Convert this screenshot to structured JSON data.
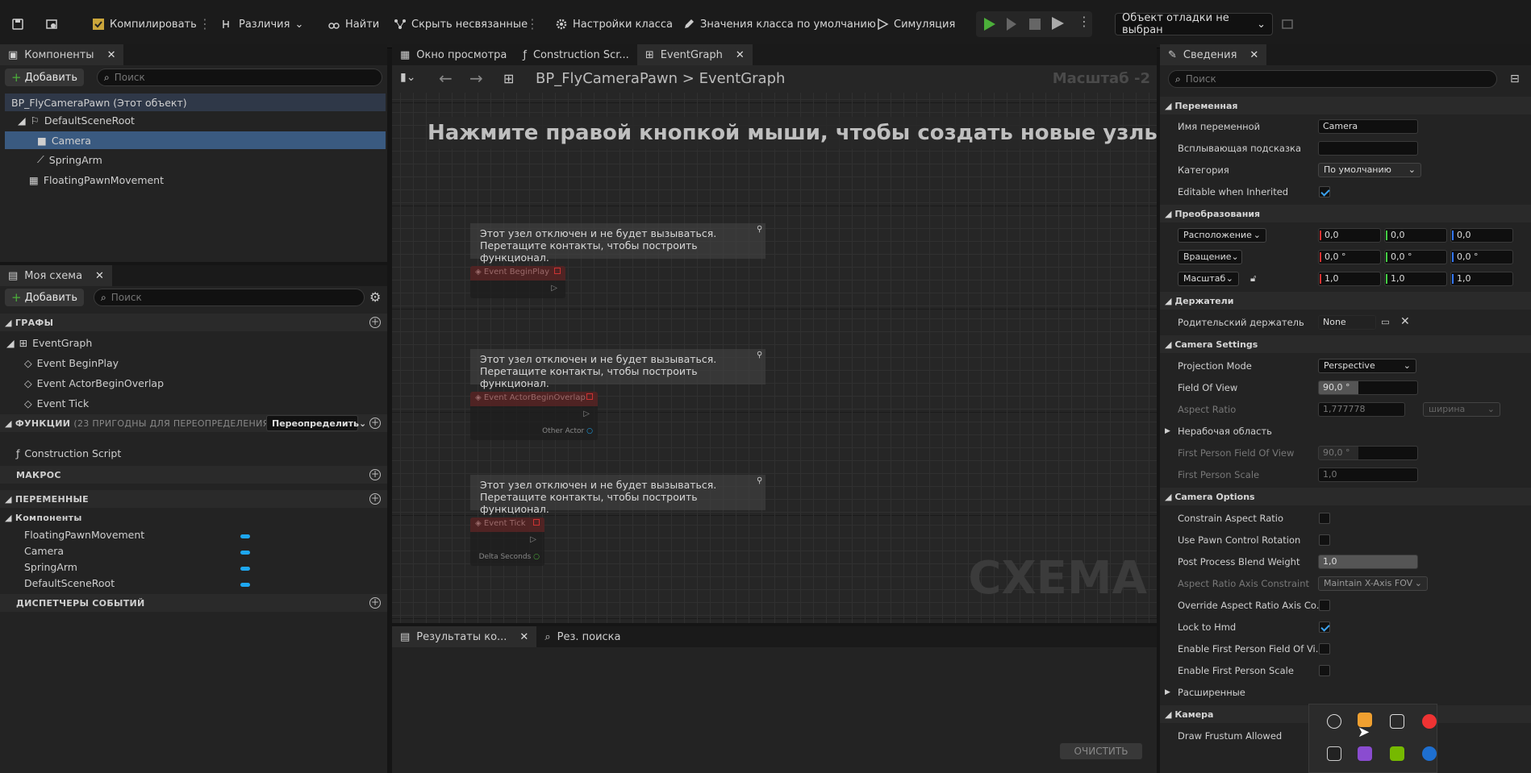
{
  "toolbar": {
    "compile": "Компилировать",
    "diff": "Различия",
    "find": "Найти",
    "hide_unrelated": "Скрыть несвязанные",
    "class_settings": "Настройки класса",
    "class_defaults": "Значения класса по умолчанию",
    "simulation": "Симуляция",
    "debug_object": "Объект отладки не выбран"
  },
  "components": {
    "tab": "Компоненты",
    "add": "Добавить",
    "search_placeholder": "Поиск",
    "items": [
      "BP_FlyCameraPawn (Этот объект)",
      "DefaultSceneRoot",
      "Camera",
      "SpringArm",
      "FloatingPawnMovement"
    ]
  },
  "myblueprint": {
    "tab": "Моя схема",
    "add": "Добавить",
    "search_placeholder": "Поиск",
    "graphs": "ГРАФЫ",
    "event_graph": "EventGraph",
    "events": [
      "Event BeginPlay",
      "Event ActorBeginOverlap",
      "Event Tick"
    ],
    "functions": "ФУНКЦИИ",
    "functions_hint": "(23 ПРИГОДНЫ ДЛЯ ПЕРЕОПРЕДЕЛЕНИЯ)",
    "override": "Переопределить",
    "construction_script": "Construction Script",
    "macros": "МАКРОС",
    "variables": "ПЕРЕМЕННЫЕ",
    "components_group": "Компоненты",
    "var_items": [
      "FloatingPawnMovement",
      "Camera",
      "SpringArm",
      "DefaultSceneRoot"
    ],
    "dispatchers": "ДИСПЕТЧЕРЫ СОБЫТИЙ"
  },
  "editor": {
    "tabs": [
      "Окно просмотра",
      "Construction Scr...",
      "EventGraph"
    ],
    "breadcrumb_root": "BP_FlyCameraPawn",
    "breadcrumb_sep": ">",
    "breadcrumb_graph": "EventGraph",
    "zoom": "Масштаб -2",
    "hint": "Нажмите правой кнопкой мыши, чтобы создать новые узлы.",
    "comment_line1": "Этот узел отключен и не будет вызываться.",
    "comment_line2": "Перетащите контакты, чтобы построить функционал.",
    "nodes": [
      "Event BeginPlay",
      "Event ActorBeginOverlap",
      "Event Tick"
    ],
    "pin_other_actor": "Other Actor",
    "pin_delta_seconds": "Delta Seconds",
    "watermark": "СХЕМА"
  },
  "results": {
    "tabs": [
      "Результаты ко...",
      "Рез. поиска"
    ],
    "clear": "ОЧИСТИТЬ"
  },
  "details": {
    "tab": "Сведения",
    "search_placeholder": "Поиск",
    "s_variable": "Переменная",
    "var_name_label": "Имя переменной",
    "var_name": "Camera",
    "tooltip_label": "Всплывающая подсказка",
    "category_label": "Категория",
    "category": "По умолчанию",
    "editable_inherited": "Editable when Inherited",
    "s_transform": "Преобразования",
    "location": "Расположение",
    "rotation": "Вращение",
    "scale": "Масштаб",
    "loc": [
      "0,0",
      "0,0",
      "0,0"
    ],
    "rot": [
      "0,0 °",
      "0,0 °",
      "0,0 °"
    ],
    "scl": [
      "1,0",
      "1,0",
      "1,0"
    ],
    "s_sockets": "Держатели",
    "parent_socket": "Родительский держатель",
    "parent_socket_val": "None",
    "s_camera_settings": "Camera Settings",
    "projection_mode": "Projection Mode",
    "projection_val": "Perspective",
    "fov": "Field Of View",
    "fov_val": "90,0 °",
    "aspect_ratio": "Aspect Ratio",
    "aspect_val": "1,777778",
    "aspect_combo": "ширина",
    "overscan": "Нерабочая область",
    "fp_fov": "First Person Field Of View",
    "fp_fov_val": "90,0 °",
    "fp_scale": "First Person Scale",
    "fp_scale_val": "1,0",
    "s_camera_options": "Camera Options",
    "constrain": "Constrain Aspect Ratio",
    "pawn_rot": "Use Pawn Control Rotation",
    "ppbw": "Post Process Blend Weight",
    "ppbw_val": "1,0",
    "axis_constraint": "Aspect Ratio Axis Constraint",
    "axis_constraint_val": "Maintain X-Axis FOV",
    "override_axis": "Override Aspect Ratio Axis Co...",
    "lock_hmd": "Lock to Hmd",
    "enable_fp_fov": "Enable First Person Field Of Vi...",
    "enable_fp_scale": "Enable First Person Scale",
    "advanced": "Расширенные",
    "s_camera": "Камера",
    "draw_frustum": "Draw Frustum Allowed"
  },
  "colors": {
    "accent": "#1ea7f0",
    "play": "#4caf3a",
    "selected_row": "#3a5a80"
  }
}
